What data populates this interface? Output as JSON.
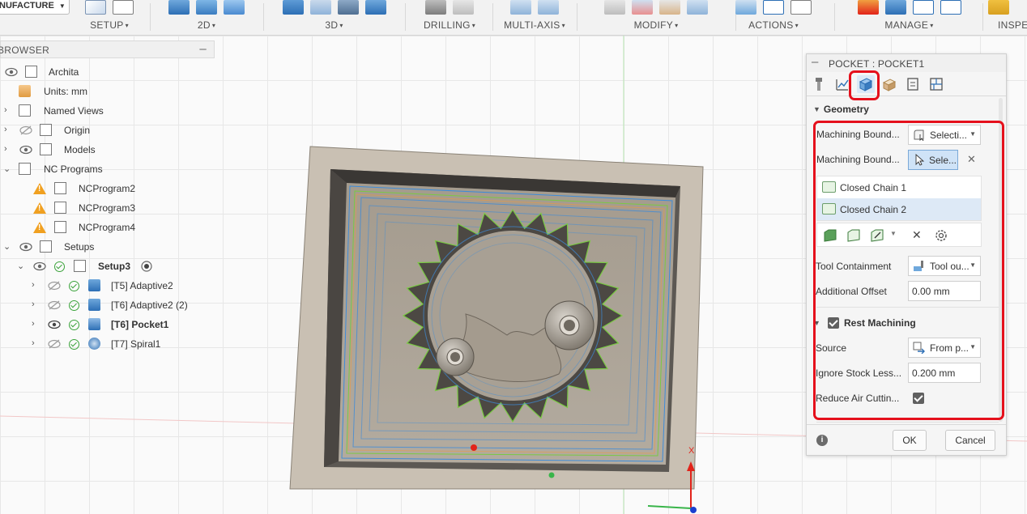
{
  "toolbar": {
    "workspace_label": "NUFACTURE",
    "groups": [
      {
        "label": "SETUP"
      },
      {
        "label": "2D"
      },
      {
        "label": "3D"
      },
      {
        "label": "DRILLING"
      },
      {
        "label": "MULTI-AXIS"
      },
      {
        "label": "MODIFY"
      },
      {
        "label": "ACTIONS"
      },
      {
        "label": "MANAGE"
      },
      {
        "label": "INSPEC"
      }
    ],
    "caret": "▾"
  },
  "browser": {
    "title": "BROWSER",
    "collapse_glyph": "–",
    "items": [
      {
        "label": "Archita"
      },
      {
        "label": "Units: mm"
      },
      {
        "label": "Named Views"
      },
      {
        "label": "Origin"
      },
      {
        "label": "Models"
      },
      {
        "label": "NC Programs"
      },
      {
        "label": "NCProgram2"
      },
      {
        "label": "NCProgram3"
      },
      {
        "label": "NCProgram4"
      },
      {
        "label": "Setups"
      },
      {
        "label": "Setup3"
      },
      {
        "label": "[T5] Adaptive2"
      },
      {
        "label": "[T6] Adaptive2 (2)"
      },
      {
        "label": "[T6] Pocket1"
      },
      {
        "label": "[T7] Spiral1"
      }
    ]
  },
  "dialog": {
    "title": "POCKET : POCKET1",
    "collapse_glyph": "–",
    "geometry_section": "Geometry",
    "machining_boundary_1": {
      "label": "Machining Bound...",
      "value": "Selecti..."
    },
    "machining_boundary_2": {
      "label": "Machining Bound...",
      "value": "Sele..."
    },
    "chains": [
      "Closed Chain 1",
      "Closed Chain 2"
    ],
    "tool_containment": {
      "label": "Tool Containment",
      "value": "Tool ou..."
    },
    "additional_offset": {
      "label": "Additional Offset",
      "value": "0.00 mm"
    },
    "rest_machining": {
      "label": "Rest Machining",
      "checked": true
    },
    "source": {
      "label": "Source",
      "value": "From p..."
    },
    "ignore_stock": {
      "label": "Ignore Stock Less...",
      "value": "0.200 mm"
    },
    "reduce_air": {
      "label": "Reduce Air Cuttin...",
      "checked": true
    },
    "ok_label": "OK",
    "cancel_label": "Cancel",
    "info_glyph": "i",
    "clear_glyph": "✕"
  },
  "axis": {
    "x_label": "X"
  },
  "colors": {
    "accent_blue": "#1a73c8",
    "highlight_red": "#e5101c",
    "stock": "#a49b8e",
    "toolpath_blue": "#3d8bd9",
    "toolpath_green": "#7ac943",
    "toolpath_orange": "#f09a3e"
  }
}
